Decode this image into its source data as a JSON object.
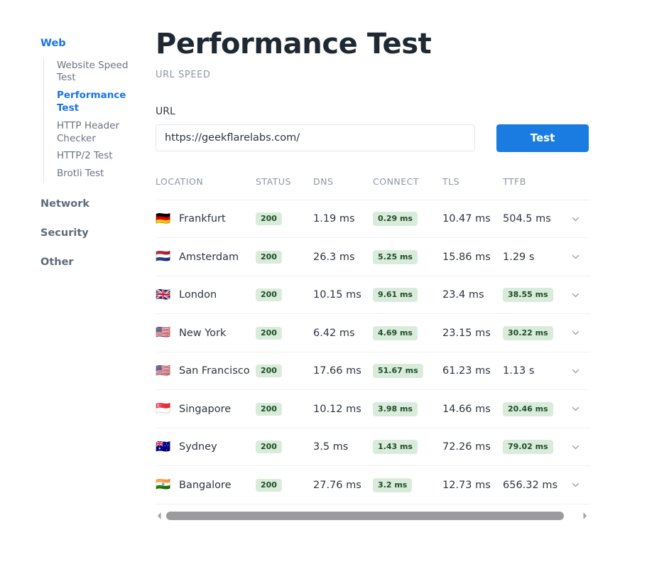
{
  "sidebar": {
    "groups": [
      {
        "label": "Web",
        "active": true,
        "items": [
          {
            "label": "Website Speed Test",
            "active": false
          },
          {
            "label": "Performance Test",
            "active": true
          },
          {
            "label": "HTTP Header Checker",
            "active": false
          },
          {
            "label": "HTTP/2 Test",
            "active": false
          },
          {
            "label": "Brotli Test",
            "active": false
          }
        ]
      }
    ],
    "standalone": [
      {
        "label": "Network"
      },
      {
        "label": "Security"
      },
      {
        "label": "Other"
      }
    ]
  },
  "header": {
    "title": "Performance Test",
    "subtitle": "URL SPEED"
  },
  "form": {
    "url_label": "URL",
    "url_value": "https://geekflarelabs.com/",
    "url_placeholder": "https://geekflarelabs.com/",
    "test_button": "Test"
  },
  "table": {
    "columns": [
      "LOCATION",
      "STATUS",
      "DNS",
      "CONNECT",
      "TLS",
      "TTFB"
    ],
    "rows": [
      {
        "flag": "🇩🇪",
        "flag_name": "flag-germany",
        "location": "Frankfurt",
        "status": "200",
        "dns": "1.19 ms",
        "connect": "0.29 ms",
        "connect_badge": true,
        "tls": "10.47 ms",
        "ttfb": "504.5 ms",
        "ttfb_badge": false
      },
      {
        "flag": "🇳🇱",
        "flag_name": "flag-netherlands",
        "location": "Amsterdam",
        "status": "200",
        "dns": "26.3 ms",
        "connect": "5.25 ms",
        "connect_badge": true,
        "tls": "15.86 ms",
        "ttfb": "1.29 s",
        "ttfb_badge": false
      },
      {
        "flag": "🇬🇧",
        "flag_name": "flag-united-kingdom",
        "location": "London",
        "status": "200",
        "dns": "10.15 ms",
        "connect": "9.61 ms",
        "connect_badge": true,
        "tls": "23.4 ms",
        "ttfb": "38.55 ms",
        "ttfb_badge": true
      },
      {
        "flag": "🇺🇸",
        "flag_name": "flag-united-states",
        "location": "New York",
        "status": "200",
        "dns": "6.42 ms",
        "connect": "4.69 ms",
        "connect_badge": true,
        "tls": "23.15 ms",
        "ttfb": "30.22 ms",
        "ttfb_badge": true
      },
      {
        "flag": "🇺🇸",
        "flag_name": "flag-united-states",
        "location": "San Francisco",
        "status": "200",
        "dns": "17.66 ms",
        "connect": "51.67 ms",
        "connect_badge": true,
        "tls": "61.23 ms",
        "ttfb": "1.13 s",
        "ttfb_badge": false
      },
      {
        "flag": "🇸🇬",
        "flag_name": "flag-singapore",
        "location": "Singapore",
        "status": "200",
        "dns": "10.12 ms",
        "connect": "3.98 ms",
        "connect_badge": true,
        "tls": "14.66 ms",
        "ttfb": "20.46 ms",
        "ttfb_badge": true
      },
      {
        "flag": "🇦🇺",
        "flag_name": "flag-australia",
        "location": "Sydney",
        "status": "200",
        "dns": "3.5 ms",
        "connect": "1.43 ms",
        "connect_badge": true,
        "tls": "72.26 ms",
        "ttfb": "79.02 ms",
        "ttfb_badge": true
      },
      {
        "flag": "🇮🇳",
        "flag_name": "flag-india",
        "location": "Bangalore",
        "status": "200",
        "dns": "27.76 ms",
        "connect": "3.2 ms",
        "connect_badge": true,
        "tls": "12.73 ms",
        "ttfb": "656.32 ms",
        "ttfb_badge": false
      }
    ]
  },
  "colors": {
    "accent": "#1a73e8",
    "button": "#1a7ce0",
    "badge_bg": "#d9ecdc",
    "badge_text": "#1f4d25",
    "muted_text": "#8d97a3",
    "scrollbar": "#9b9b9d"
  }
}
